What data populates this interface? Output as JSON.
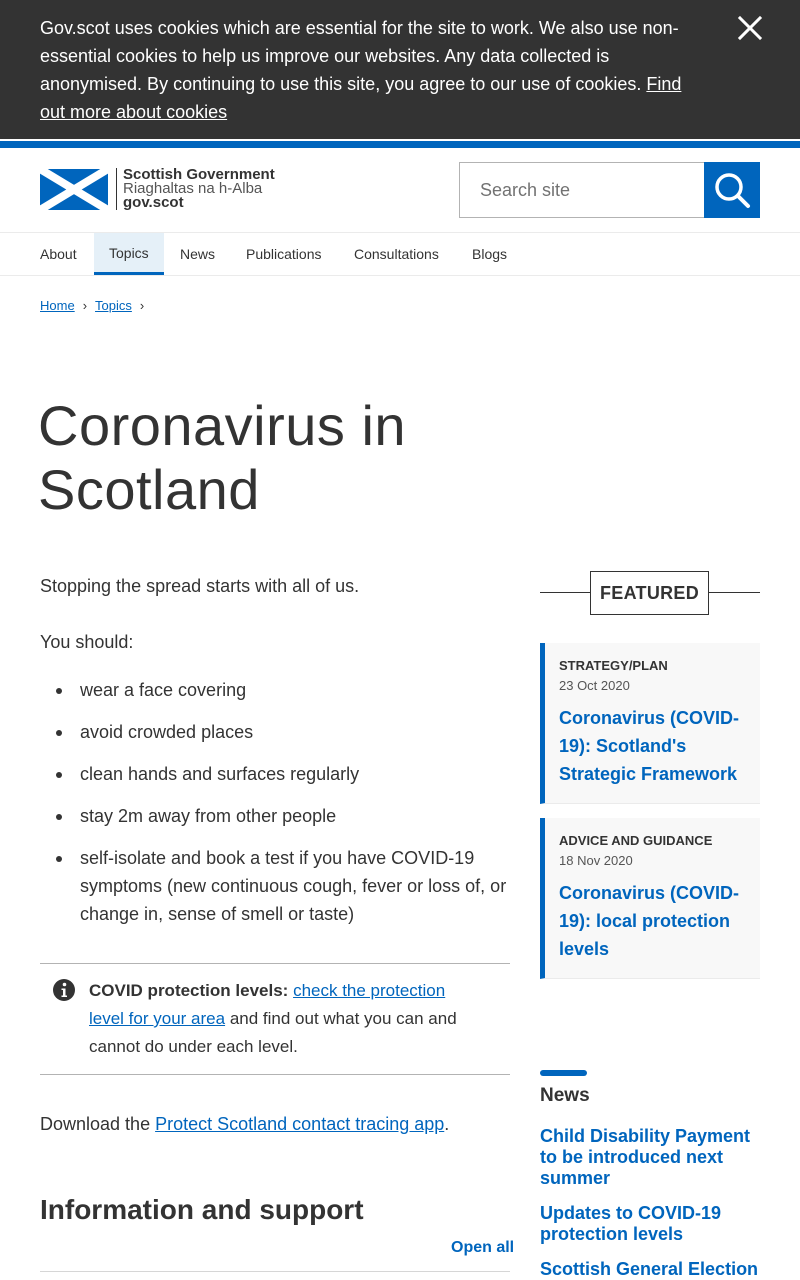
{
  "cookie_banner": {
    "text": "Gov.scot uses cookies which are essential for the site to work. We also use non-essential cookies to help us improve our websites. Any data collected is anonymised. By continuing to use this site, you agree to our use of cookies.",
    "link": "Find out more about cookies",
    "close_icon": "close-icon"
  },
  "header": {
    "logo_line1": "Scottish Government",
    "logo_line2": "Riaghaltas na h-Alba",
    "logo_line3": "gov.scot",
    "search_placeholder": "Search site",
    "search_icon": "search-icon"
  },
  "nav": {
    "items": [
      {
        "label": "About"
      },
      {
        "label": "Topics"
      },
      {
        "label": "News"
      },
      {
        "label": "Publications"
      },
      {
        "label": "Consultations"
      },
      {
        "label": "Blogs"
      }
    ],
    "active": "Topics"
  },
  "breadcrumb": {
    "items": [
      "Home",
      "Topics"
    ]
  },
  "page": {
    "title": "Coronavirus in Scotland",
    "intro": "Stopping the spread starts with all of us.",
    "you_should": "You should:",
    "bullets": [
      "wear a face covering",
      "avoid crowded places",
      "clean hands and surfaces regularly",
      "stay 2m away from other people",
      "self-isolate and book a test if you have COVID-19 symptoms (new continuous cough, fever or loss of, or change in, sense of smell or taste)"
    ],
    "info": {
      "label": "COVID protection levels:",
      "link": "check the protection level for your area",
      "rest": "and find out what you can and cannot do under each level."
    },
    "download": {
      "prefix": "Download the",
      "link": "Protect Scotland contact tracing app",
      "suffix": "."
    },
    "section_title": "Information and support",
    "open_all": "Open all"
  },
  "sidebar": {
    "featured_label": "FEATURED",
    "cards": [
      {
        "type": "STRATEGY/PLAN",
        "date": "23 Oct 2020",
        "title": "Coronavirus (COVID-19): Scotland's Strategic Framework"
      },
      {
        "type": "ADVICE AND GUIDANCE",
        "date": "18 Nov 2020",
        "title": "Coronavirus (COVID-19): local protection levels"
      }
    ],
    "news_title": "News",
    "news": [
      "Child Disability Payment to be introduced next summer",
      "Updates to COVID-19 protection levels",
      "Scottish General Election"
    ]
  },
  "colors": {
    "brand_blue": "#0065bd",
    "banner_bg": "#333333",
    "text": "#333333"
  }
}
